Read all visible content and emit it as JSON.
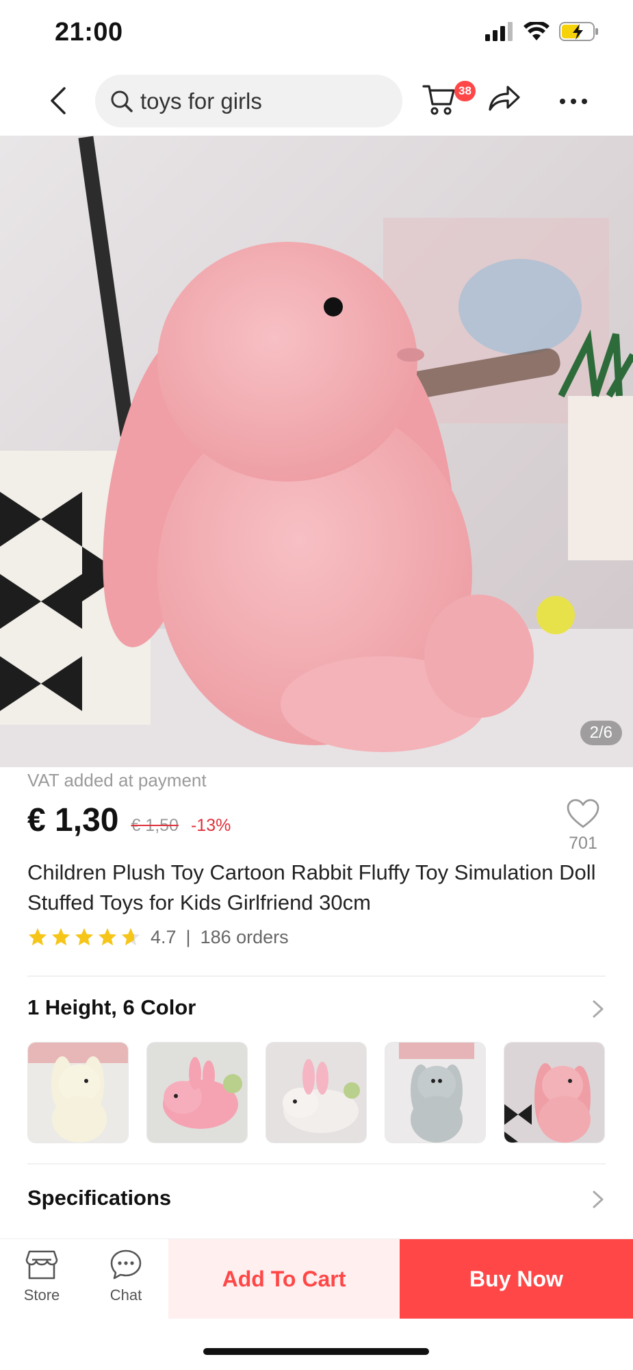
{
  "status_bar": {
    "time": "21:00"
  },
  "header": {
    "search_text": "toys for girls",
    "cart_count": "38"
  },
  "gallery": {
    "counter": "2/6"
  },
  "product": {
    "vat_note": "VAT added at payment",
    "price": "€ 1,30",
    "old_price": "€ 1,50",
    "discount": "-13%",
    "wishlist_count": "701",
    "title": "Children Plush Toy Cartoon Rabbit Fluffy Toy Simulation Doll Stuffed Toys for Kids Girlfriend  30cm",
    "rating": "4.7",
    "rating_separator": "|",
    "orders": "186 orders"
  },
  "variants": {
    "title": "1 Height, 6 Color",
    "thumbnails": [
      "cream bunny",
      "pink lying bunny",
      "white lying bunny",
      "grey bunny",
      "pink bunny"
    ]
  },
  "specifications": {
    "title": "Specifications"
  },
  "bottom_bar": {
    "store_label": "Store",
    "chat_label": "Chat",
    "add_to_cart": "Add To Cart",
    "buy_now": "Buy Now"
  },
  "colors": {
    "accent": "#ff4747",
    "accent_light": "#ffefef",
    "discount": "#e0303a",
    "star": "#f5c518"
  }
}
